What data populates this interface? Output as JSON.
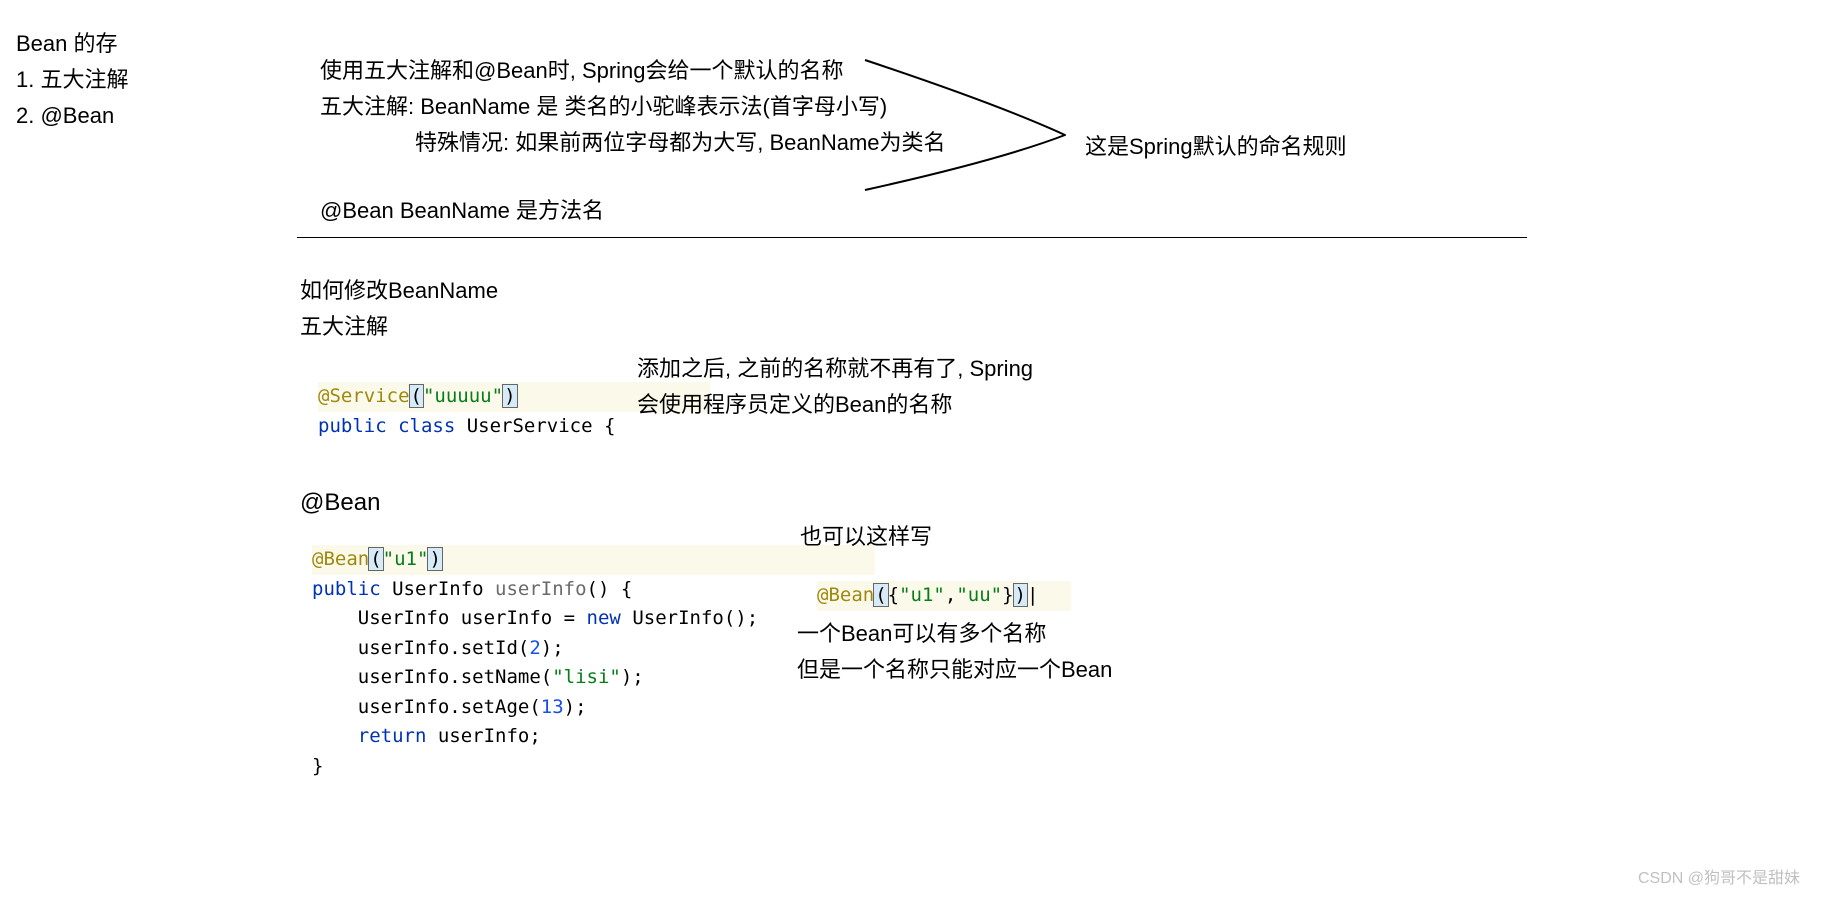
{
  "sidebar": {
    "title": "Bean 的存",
    "item1": "1. 五大注解",
    "item2": "2. @Bean"
  },
  "top": {
    "line1": "使用五大注解和@Bean时, Spring会给一个默认的名称",
    "line2": "五大注解: BeanName 是 类名的小驼峰表示法(首字母小写)",
    "line3": "特殊情况: 如果前两位字母都为大写, BeanName为类名",
    "line4": "@Bean  BeanName 是方法名",
    "callout": "这是Spring默认的命名规则"
  },
  "section2": {
    "title": "如何修改BeanName",
    "sub1": "五大注解",
    "note1a": "添加之后, 之前的名称就不再有了, Spring",
    "note1b": "会使用程序员定义的Bean的名称",
    "sub2": "@Bean",
    "note2a": "也可以这样写",
    "note2b": "一个Bean可以有多个名称",
    "note2c": "但是一个名称只能对应一个Bean"
  },
  "code1": {
    "ann": "@Service",
    "paren1": "(",
    "q1": "\"",
    "val": "uuuuu",
    "q2": "\"",
    "paren2": ")",
    "line2_pub": "public",
    "line2_cls": " class",
    "line2_rest": " UserService {"
  },
  "code2": {
    "ann": "@Bean",
    "p1": "(",
    "q1": "\"",
    "val": "u1",
    "q2": "\"",
    "p2": ")",
    "l2_pub": "public",
    "l2_type": " UserInfo ",
    "l2_name": "userInfo",
    "l2_rest": "() {",
    "l3a": "    UserInfo userInfo = ",
    "l3_new": "new",
    "l3b": " UserInfo();",
    "l4a": "    userInfo.setId(",
    "l4n": "2",
    "l4b": ");",
    "l5a": "    userInfo.setName(",
    "l5s": "\"lisi\"",
    "l5b": ");",
    "l6a": "    userInfo.setAge(",
    "l6n": "13",
    "l6b": ");",
    "l7_ret": "    return",
    "l7b": " userInfo;",
    "l8": "}"
  },
  "code3": {
    "ann": "@Bean",
    "rest1": "({",
    "s1": "\"u1\"",
    "comma": ",",
    "s2": "\"uu\"",
    "rest2": "})|"
  },
  "watermark": "CSDN @狗哥不是甜妹"
}
